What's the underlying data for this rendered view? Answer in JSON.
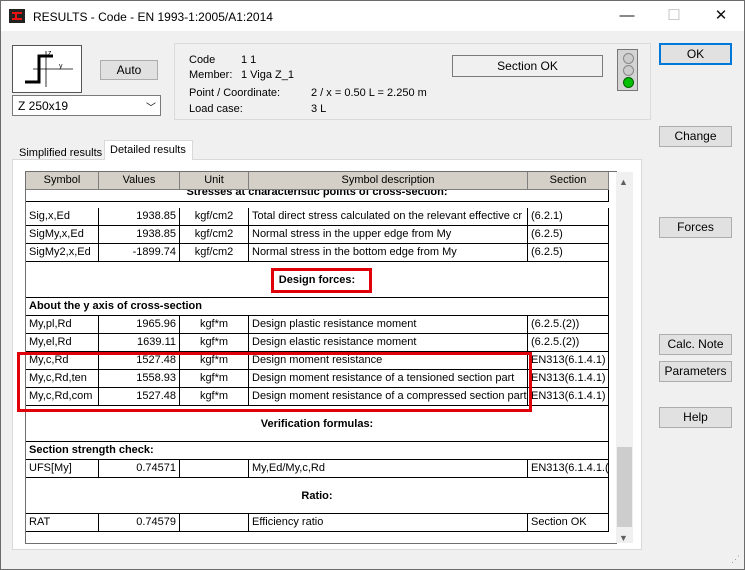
{
  "window": {
    "title": "RESULTS - Code - EN 1993-1:2005/A1:2014",
    "minimize": "—",
    "maximize": "☐",
    "close": "✕"
  },
  "section": {
    "auto_label": "Auto",
    "profile": "Z 250x19"
  },
  "info": {
    "code_label": "Code",
    "code_value": "1  1",
    "member_label": "Member:",
    "member_value": "1  Viga Z_1",
    "point_label": "Point / Coordinate:",
    "point_value": "2 / x = 0.50 L = 2.250 m",
    "load_label": "Load case:",
    "load_value": "3 L",
    "status": "Section OK",
    "status_color": "#00c000"
  },
  "tabs": {
    "simplified": "Simplified results",
    "detailed": "Detailed results"
  },
  "table": {
    "headers": [
      "Symbol",
      "Values",
      "Unit",
      "Symbol description",
      "Section"
    ],
    "partial_heading": "Stresses at characteristic points of cross-section:",
    "stress_rows": [
      {
        "symbol": "Sig,x,Ed",
        "value": "1938.85",
        "unit": "kgf/cm2",
        "desc": "Total direct stress calculated on the relevant effective cr",
        "section": "(6.2.1)"
      },
      {
        "symbol": "SigMy,x,Ed",
        "value": "1938.85",
        "unit": "kgf/cm2",
        "desc": "Normal stress in the upper edge from My",
        "section": "(6.2.5)"
      },
      {
        "symbol": "SigMy2,x,Ed",
        "value": "-1899.74",
        "unit": "kgf/cm2",
        "desc": "Normal stress in the bottom edge from My",
        "section": "(6.2.5)"
      }
    ],
    "design_forces_heading": "Design forces:",
    "y_axis_heading": "About the y axis of cross-section",
    "moment_rows": [
      {
        "symbol": "My,pl,Rd",
        "value": "1965.96",
        "unit": "kgf*m",
        "desc": "Design plastic resistance moment",
        "section": "(6.2.5.(2))"
      },
      {
        "symbol": "My,el,Rd",
        "value": "1639.11",
        "unit": "kgf*m",
        "desc": "Design elastic resistance moment",
        "section": "(6.2.5.(2))"
      },
      {
        "symbol": "My,c,Rd",
        "value": "1527.48",
        "unit": "kgf*m",
        "desc": "Design moment resistance",
        "section": "EN313(6.1.4.1)"
      },
      {
        "symbol": "My,c,Rd,ten",
        "value": "1558.93",
        "unit": "kgf*m",
        "desc": "Design moment resistance of a tensioned section part",
        "section": "EN313(6.1.4.1)"
      },
      {
        "symbol": "My,c,Rd,com",
        "value": "1527.48",
        "unit": "kgf*m",
        "desc": "Design moment resistance of a compressed section part",
        "section": "EN313(6.1.4.1)"
      }
    ],
    "verification_heading": "Verification formulas:",
    "strength_heading": "Section strength check:",
    "ufs_row": {
      "symbol": "UFS[My]",
      "value": "0.74571",
      "unit": "",
      "desc": "My,Ed/My,c,Rd",
      "section": "EN313(6.1.4.1.("
    },
    "ratio_heading": "Ratio:",
    "rat_row": {
      "symbol": "RAT",
      "value": "0.74579",
      "unit": "",
      "desc": "Efficiency ratio",
      "section": "Section OK"
    }
  },
  "buttons": {
    "ok": "OK",
    "change": "Change",
    "forces": "Forces",
    "calc_note": "Calc. Note",
    "parameters": "Parameters",
    "help": "Help"
  },
  "colors": {
    "highlight": "#e0000a",
    "header_bg": "#d4d0c8",
    "focus": "#0078d7"
  }
}
